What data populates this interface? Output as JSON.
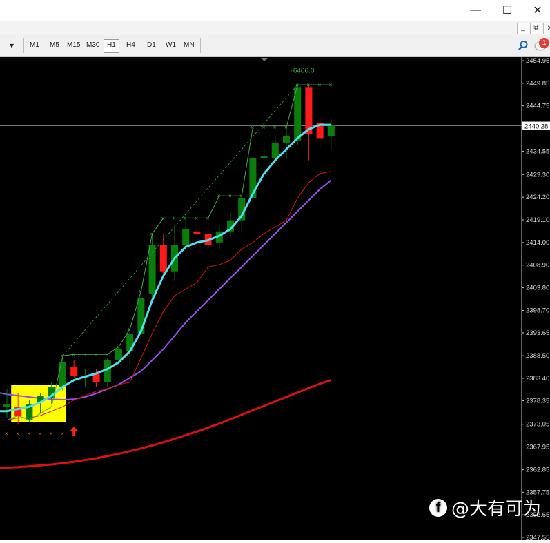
{
  "window": {
    "minimize_glyph": "—",
    "maximize_glyph": "☐",
    "close_glyph": "✕"
  },
  "mdi": {
    "min": "_",
    "restore": "⧉",
    "close": "x"
  },
  "toolbar": {
    "dropdown_glyph": "▾",
    "timeframes": [
      "M1",
      "M5",
      "M15",
      "M30",
      "H1",
      "H4",
      "D1",
      "W1",
      "MN"
    ],
    "active_timeframe": "H1",
    "notification_count": "1"
  },
  "chart": {
    "profit_label": "+6406.0",
    "current_price": "2440.28",
    "price_axis": [
      "2454.95",
      "2449.85",
      "2444.75",
      "2434.55",
      "2429.30",
      "2424.20",
      "2419.10",
      "2414.00",
      "2408.90",
      "2403.80",
      "2398.70",
      "2393.65",
      "2388.50",
      "2383.40",
      "2378.35",
      "2373.05",
      "2367.95",
      "2362.85",
      "2357.75",
      "2352.65",
      "2347.55"
    ],
    "colors": {
      "bull": "#0a7d0a",
      "bear": "#ff1a1a",
      "cyan_ma": "#4fe0f0",
      "purple_ma": "#9a4ff0",
      "red_ma": "#dd1010",
      "signal": "#3cb04a",
      "highlight": "#ffff00"
    }
  },
  "chart_data": {
    "type": "candlestick",
    "symbol_timeframe": "H1",
    "ylim": [
      2345.0,
      2457.5
    ],
    "candles": [
      {
        "o": 2377.0,
        "h": 2381.0,
        "l": 2374.5,
        "c": 2377.5
      },
      {
        "o": 2377.0,
        "h": 2380.0,
        "l": 2373.0,
        "c": 2375.0
      },
      {
        "o": 2374.0,
        "h": 2378.5,
        "l": 2373.5,
        "c": 2377.5
      },
      {
        "o": 2378.0,
        "h": 2380.0,
        "l": 2375.5,
        "c": 2379.5
      },
      {
        "o": 2379.0,
        "h": 2382.5,
        "l": 2377.5,
        "c": 2381.5
      },
      {
        "o": 2381.5,
        "h": 2388.0,
        "l": 2380.5,
        "c": 2387.0
      },
      {
        "o": 2386.0,
        "h": 2387.5,
        "l": 2383.5,
        "c": 2384.0
      },
      {
        "o": 2383.5,
        "h": 2385.5,
        "l": 2381.5,
        "c": 2384.0
      },
      {
        "o": 2384.5,
        "h": 2385.5,
        "l": 2381.5,
        "c": 2382.5
      },
      {
        "o": 2382.5,
        "h": 2388.0,
        "l": 2381.5,
        "c": 2387.5
      },
      {
        "o": 2387.5,
        "h": 2390.5,
        "l": 2386.5,
        "c": 2390.0
      },
      {
        "o": 2389.5,
        "h": 2394.5,
        "l": 2386.5,
        "c": 2393.5
      },
      {
        "o": 2393.5,
        "h": 2403.0,
        "l": 2392.5,
        "c": 2401.5
      },
      {
        "o": 2402.5,
        "h": 2416.0,
        "l": 2401.5,
        "c": 2413.5
      },
      {
        "o": 2413.5,
        "h": 2416.0,
        "l": 2406.0,
        "c": 2407.5
      },
      {
        "o": 2407.5,
        "h": 2418.0,
        "l": 2405.5,
        "c": 2413.5
      },
      {
        "o": 2413.5,
        "h": 2420.5,
        "l": 2412.5,
        "c": 2417.0
      },
      {
        "o": 2416.5,
        "h": 2418.5,
        "l": 2413.0,
        "c": 2416.0
      },
      {
        "o": 2416.0,
        "h": 2418.5,
        "l": 2412.5,
        "c": 2413.5
      },
      {
        "o": 2414.0,
        "h": 2418.0,
        "l": 2412.5,
        "c": 2416.5
      },
      {
        "o": 2416.5,
        "h": 2420.5,
        "l": 2415.5,
        "c": 2419.0
      },
      {
        "o": 2419.0,
        "h": 2425.0,
        "l": 2416.5,
        "c": 2424.0
      },
      {
        "o": 2424.0,
        "h": 2433.5,
        "l": 2423.0,
        "c": 2433.0
      },
      {
        "o": 2433.0,
        "h": 2437.0,
        "l": 2429.5,
        "c": 2433.5
      },
      {
        "o": 2433.0,
        "h": 2438.0,
        "l": 2432.0,
        "c": 2436.5
      },
      {
        "o": 2436.5,
        "h": 2440.0,
        "l": 2433.0,
        "c": 2438.0
      },
      {
        "o": 2437.0,
        "h": 2449.5,
        "l": 2436.0,
        "c": 2449.0
      },
      {
        "o": 2449.0,
        "h": 2449.5,
        "l": 2432.5,
        "c": 2438.5
      },
      {
        "o": 2441.0,
        "h": 2442.5,
        "l": 2435.5,
        "c": 2437.5
      },
      {
        "o": 2438.0,
        "h": 2442.0,
        "l": 2435.0,
        "c": 2440.5
      }
    ],
    "cyan_ma": [
      2376.0,
      2376.5,
      2377.0,
      2378.0,
      2379.5,
      2381.5,
      2383.0,
      2383.8,
      2384.5,
      2385.5,
      2387.0,
      2389.5,
      2394.0,
      2401.0,
      2406.5,
      2410.5,
      2413.0,
      2414.0,
      2414.5,
      2415.5,
      2417.0,
      2420.0,
      2425.0,
      2429.5,
      2432.5,
      2435.0,
      2437.5,
      2439.5,
      2440.5,
      2440.5
    ],
    "red_thin_ma": [
      2374.0,
      2374.5,
      2374.5,
      2375.0,
      2376.0,
      2377.0,
      2378.5,
      2379.5,
      2380.5,
      2381.0,
      2382.0,
      2382.5,
      2388.0,
      2393.5,
      2398.5,
      2402.0,
      2403.5,
      2405.0,
      2408.5,
      2409.0,
      2410.0,
      2412.5,
      2414.0,
      2416.0,
      2417.5,
      2419.0,
      2424.0,
      2427.5,
      2429.5,
      2430.0
    ],
    "purple_ma": [
      2379.8,
      2379.5,
      2379.2,
      2378.9,
      2378.7,
      2378.6,
      2378.7,
      2379.2,
      2380.0,
      2381.0,
      2382.0,
      2383.5,
      2385.0,
      2387.5,
      2390.0,
      2393.0,
      2396.0,
      2398.5,
      2401.0,
      2403.5,
      2406.0,
      2408.5,
      2411.0,
      2413.5,
      2416.0,
      2418.5,
      2421.0,
      2423.5,
      2426.0,
      2428.0
    ],
    "red_thick_ma": [
      2363.3,
      2363.4,
      2363.6,
      2363.8,
      2364.0,
      2364.3,
      2364.6,
      2365.0,
      2365.4,
      2365.9,
      2366.4,
      2367.0,
      2367.6,
      2368.3,
      2369.0,
      2369.8,
      2370.6,
      2371.4,
      2372.3,
      2373.2,
      2374.2,
      2375.2,
      2376.2,
      2377.2,
      2378.2,
      2379.2,
      2380.2,
      2381.2,
      2382.2,
      2383.0
    ],
    "signal_line": [
      2374.0,
      2375.0,
      2374.0,
      2375.5,
      2377.0,
      2388.5,
      2388.8,
      2388.8,
      2388.8,
      2388.8,
      2390.5,
      2394.5,
      2403.0,
      2416.0,
      2419.5,
      2419.5,
      2419.5,
      2419.5,
      2419.5,
      2424.5,
      2424.5,
      2424.5,
      2440.0,
      2440.0,
      2440.0,
      2440.0,
      2449.5,
      2449.5,
      2449.5,
      2449.5
    ],
    "highlight_box": {
      "first_candle": 1,
      "last_candle": 5,
      "price_top": 2382.0,
      "price_bottom": 2373.5
    }
  }
}
